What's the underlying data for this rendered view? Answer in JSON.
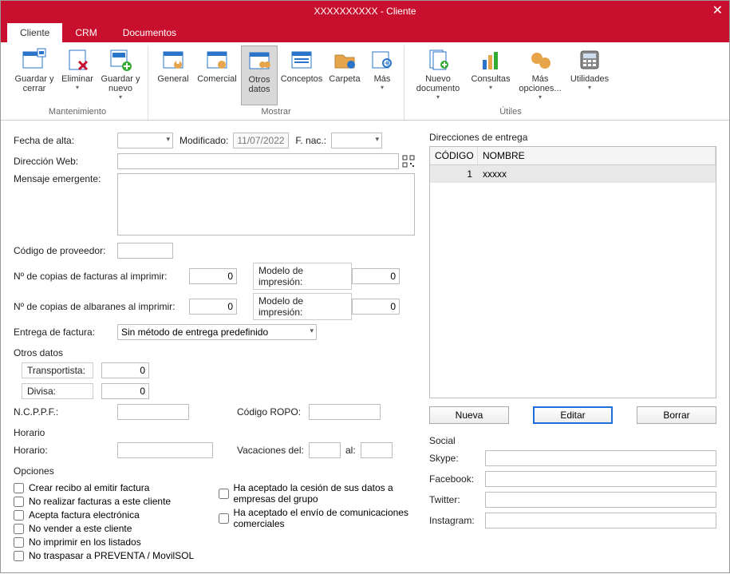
{
  "window": {
    "title": "XXXXXXXXXX - Cliente"
  },
  "tabs": [
    {
      "label": "Cliente",
      "active": true
    },
    {
      "label": "CRM"
    },
    {
      "label": "Documentos"
    }
  ],
  "ribbon": {
    "mantenimiento": {
      "label": "Mantenimiento",
      "save_close": "Guardar y cerrar",
      "delete": "Eliminar",
      "save_new": "Guardar y nuevo"
    },
    "mostrar": {
      "label": "Mostrar",
      "general": "General",
      "comercial": "Comercial",
      "otros_datos": "Otros datos",
      "conceptos": "Conceptos",
      "carpeta": "Carpeta",
      "mas": "Más"
    },
    "utiles": {
      "label": "Útiles",
      "nuevo_documento": "Nuevo documento",
      "consultas": "Consultas",
      "mas_opciones": "Más opciones...",
      "utilidades": "Utilidades"
    }
  },
  "form": {
    "fecha_alta_label": "Fecha de alta:",
    "fecha_alta_value": "",
    "modificado_label": "Modificado:",
    "modificado_value": "11/07/2022",
    "f_nac_label": "F. nac.:",
    "f_nac_value": "",
    "direccion_web_label": "Dirección Web:",
    "direccion_web_value": "",
    "mensaje_emergente_label": "Mensaje emergente:",
    "mensaje_emergente_value": "",
    "codigo_proveedor_label": "Código de proveedor:",
    "codigo_proveedor_value": "",
    "num_copias_fact_label": "Nº de copias de facturas al imprimir:",
    "num_copias_fact_value": "0",
    "modelo_impresion1_label": "Modelo de impresión:",
    "modelo_impresion1_value": "0",
    "num_copias_alb_label": "Nº de copias de albaranes al imprimir:",
    "num_copias_alb_value": "0",
    "modelo_impresion2_label": "Modelo de impresión:",
    "modelo_impresion2_value": "0",
    "entrega_factura_label": "Entrega de factura:",
    "entrega_factura_value": "Sin método de entrega predefinido",
    "otros_datos_title": "Otros datos",
    "transportista_label": "Transportista:",
    "transportista_value": "0",
    "divisa_label": "Divisa:",
    "divisa_value": "0",
    "ncppf_label": "N.C.P.P.F.:",
    "ncppf_value": "",
    "codigo_ropo_label": "Código ROPO:",
    "codigo_ropo_value": "",
    "horario_title": "Horario",
    "horario_label": "Horario:",
    "horario_value": "",
    "vacaciones_label": "Vacaciones del:",
    "vacaciones_del_value": "",
    "vacaciones_al_label": "al:",
    "vacaciones_al_value": "",
    "opciones_title": "Opciones",
    "opt_crear_recibo": "Crear recibo al emitir factura",
    "opt_no_facturas": "No realizar facturas a este cliente",
    "opt_acepta_electronica": "Acepta factura electrónica",
    "opt_no_vender": "No vender a este cliente",
    "opt_no_imprimir": "No imprimir en los listados",
    "opt_no_traspasar": "No traspasar a PREVENTA / MovilSOL",
    "opt_cesion_datos": "Ha aceptado la cesión de sus datos a empresas del grupo",
    "opt_envio_comunicaciones": "Ha aceptado el envío de comunicaciones comerciales"
  },
  "direcciones": {
    "title": "Direcciones de entrega",
    "col_codigo": "CÓDIGO",
    "col_nombre": "NOMBRE",
    "rows": [
      {
        "codigo": "1",
        "nombre": "xxxxx"
      }
    ],
    "nueva": "Nueva",
    "editar": "Editar",
    "borrar": "Borrar"
  },
  "social": {
    "title": "Social",
    "skype_label": "Skype:",
    "skype_value": "",
    "facebook_label": "Facebook:",
    "facebook_value": "",
    "twitter_label": "Twitter:",
    "twitter_value": "",
    "instagram_label": "Instagram:",
    "instagram_value": ""
  }
}
